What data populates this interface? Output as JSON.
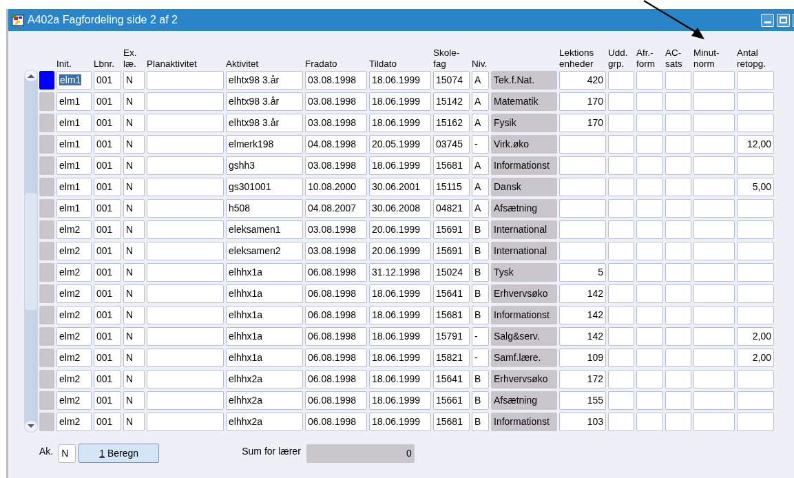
{
  "window": {
    "title": "A402a Fagfordeling side 2 af 2"
  },
  "headers": [
    [
      "Init."
    ],
    [
      "Lbnr."
    ],
    [
      "Ex.",
      "læ."
    ],
    [
      "Planaktivitet"
    ],
    [
      "Aktivitet"
    ],
    [
      "Fradato"
    ],
    [
      "Tildato"
    ],
    [
      "Skole-",
      "fag"
    ],
    [
      "Niv."
    ],
    [
      "Lektions",
      "enheder"
    ],
    [
      "Udd.",
      "grp."
    ],
    [
      "Afr.-",
      "form"
    ],
    [
      "AC-",
      "sats"
    ],
    [
      "Minut-",
      "norm"
    ],
    [
      "Antal",
      "retopg."
    ]
  ],
  "rows": [
    {
      "selected": true,
      "init": "elm1",
      "lbnr": "001",
      "ex": "N",
      "aktivitet": "elhtx98 3.år",
      "fradato": "03.08.1998",
      "tildato": "18.06.1999",
      "skolefag": "15074",
      "niv": "A",
      "fag": "Tek.f.Nat.",
      "lektioner": "420"
    },
    {
      "selected": false,
      "init": "elm1",
      "lbnr": "001",
      "ex": "N",
      "aktivitet": "elhtx98 3.år",
      "fradato": "03.08.1998",
      "tildato": "18.06.1999",
      "skolefag": "15142",
      "niv": "A",
      "fag": "Matematik",
      "lektioner": "170"
    },
    {
      "selected": false,
      "init": "elm1",
      "lbnr": "001",
      "ex": "N",
      "aktivitet": "elhtx98 3.år",
      "fradato": "03.08.1998",
      "tildato": "18.06.1999",
      "skolefag": "15162",
      "niv": "A",
      "fag": "Fysik",
      "lektioner": "170"
    },
    {
      "selected": false,
      "init": "elm1",
      "lbnr": "001",
      "ex": "N",
      "aktivitet": "elmerk198",
      "fradato": "04.08.1998",
      "tildato": "20.05.1999",
      "skolefag": "03745",
      "niv": "-",
      "fag": "Virk.øko",
      "antal_retopg": "12,00"
    },
    {
      "selected": false,
      "init": "elm1",
      "lbnr": "001",
      "ex": "N",
      "aktivitet": "gshh3",
      "fradato": "03.08.1998",
      "tildato": "18.06.1999",
      "skolefag": "15681",
      "niv": "A",
      "fag": "Informationst"
    },
    {
      "selected": false,
      "init": "elm1",
      "lbnr": "001",
      "ex": "N",
      "aktivitet": "gs301001",
      "fradato": "10.08.2000",
      "tildato": "30.06.2001",
      "skolefag": "15115",
      "niv": "A",
      "fag": "Dansk",
      "antal_retopg": "5,00"
    },
    {
      "selected": false,
      "init": "elm1",
      "lbnr": "001",
      "ex": "N",
      "aktivitet": "h508",
      "fradato": "04.08.2007",
      "tildato": "30.06.2008",
      "skolefag": "04821",
      "niv": "A",
      "fag": "Afsætning"
    },
    {
      "selected": false,
      "init": "elm2",
      "lbnr": "001",
      "ex": "N",
      "aktivitet": "eleksamen1",
      "fradato": "03.08.1998",
      "tildato": "20.06.1999",
      "skolefag": "15691",
      "niv": "B",
      "fag": "International"
    },
    {
      "selected": false,
      "init": "elm2",
      "lbnr": "001",
      "ex": "N",
      "aktivitet": "eleksamen2",
      "fradato": "03.08.1998",
      "tildato": "20.06.1999",
      "skolefag": "15691",
      "niv": "B",
      "fag": "International"
    },
    {
      "selected": false,
      "init": "elm2",
      "lbnr": "001",
      "ex": "N",
      "aktivitet": "elhhx1a",
      "fradato": "06.08.1998",
      "tildato": "31.12.1998",
      "skolefag": "15024",
      "niv": "B",
      "fag": "Tysk",
      "lektioner": "5"
    },
    {
      "selected": false,
      "init": "elm2",
      "lbnr": "001",
      "ex": "N",
      "aktivitet": "elhhx1a",
      "fradato": "06.08.1998",
      "tildato": "18.06.1999",
      "skolefag": "15641",
      "niv": "B",
      "fag": "Erhvervsøko",
      "lektioner": "142"
    },
    {
      "selected": false,
      "init": "elm2",
      "lbnr": "001",
      "ex": "N",
      "aktivitet": "elhhx1a",
      "fradato": "06.08.1998",
      "tildato": "18.06.1999",
      "skolefag": "15681",
      "niv": "B",
      "fag": "Informationst",
      "lektioner": "142"
    },
    {
      "selected": false,
      "init": "elm2",
      "lbnr": "001",
      "ex": "N",
      "aktivitet": "elhhx1a",
      "fradato": "06.08.1998",
      "tildato": "18.06.1999",
      "skolefag": "15791",
      "niv": "-",
      "fag": "Salg&serv.",
      "lektioner": "142",
      "antal_retopg": "2,00"
    },
    {
      "selected": false,
      "init": "elm2",
      "lbnr": "001",
      "ex": "N",
      "aktivitet": "elhhx1a",
      "fradato": "06.08.1998",
      "tildato": "18.06.1999",
      "skolefag": "15821",
      "niv": "-",
      "fag": "Samf.lære.",
      "lektioner": "109",
      "antal_retopg": "2,00"
    },
    {
      "selected": false,
      "init": "elm2",
      "lbnr": "001",
      "ex": "N",
      "aktivitet": "elhhx2a",
      "fradato": "06.08.1998",
      "tildato": "18.06.1999",
      "skolefag": "15641",
      "niv": "B",
      "fag": "Erhvervsøko",
      "lektioner": "172"
    },
    {
      "selected": false,
      "init": "elm2",
      "lbnr": "001",
      "ex": "N",
      "aktivitet": "elhhx2a",
      "fradato": "06.08.1998",
      "tildato": "18.06.1999",
      "skolefag": "15661",
      "niv": "B",
      "fag": "Afsætning",
      "lektioner": "155"
    },
    {
      "selected": false,
      "init": "elm2",
      "lbnr": "001",
      "ex": "N",
      "aktivitet": "elhhx2a",
      "fradato": "06.08.1998",
      "tildato": "18.06.1999",
      "skolefag": "15681",
      "niv": "B",
      "fag": "Informationst",
      "lektioner": "103"
    }
  ],
  "footer": {
    "ak_label": "Ak.",
    "ak_value": "N",
    "button": {
      "access_key": "1",
      "label": "Beregn"
    },
    "sum_label": "Sum for lærer",
    "sum_value": "0"
  }
}
